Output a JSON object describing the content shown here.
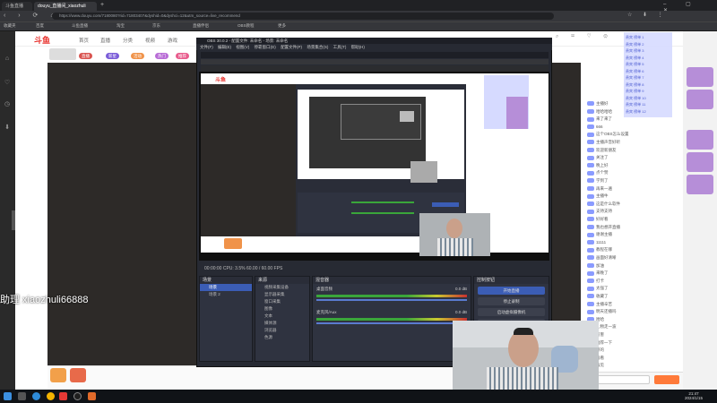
{
  "browser": {
    "tabs": [
      {
        "label": "斗鱼直播",
        "active": false
      },
      {
        "label": "douyu_直播间_xiaozhuli",
        "active": true
      },
      {
        "label": "",
        "active": false
      }
    ],
    "url": "https://www.douyu.com/7180080?rid=71803407&dyshid=0&dyshci=12&utm_source=live_recommend",
    "bookmarks": [
      "收藏夹",
      "百度",
      "斗鱼直播",
      "淘宝",
      "京东",
      "直播伴侣",
      "OBS教程",
      "更多"
    ]
  },
  "site": {
    "logo": "斗鱼",
    "nav": [
      "首页",
      "直播",
      "分类",
      "视频",
      "游戏"
    ],
    "chips": [
      "直播",
      "新星",
      "活动",
      "热门",
      "推荐"
    ],
    "rail_icons": [
      "home-icon",
      "follow-icon",
      "history-icon",
      "download-icon"
    ]
  },
  "obs": {
    "title": "OBS 30.0.2 - 配置文件: 未命名 - 场景: 未命名",
    "menu": [
      "文件(F)",
      "编辑(E)",
      "视图(V)",
      "停靠窗口(D)",
      "配置文件(P)",
      "场景集合(S)",
      "工具(T)",
      "帮助(H)"
    ],
    "scenes_header": "场景",
    "sources_header": "来源",
    "mixer_header": "混音器",
    "controls_header": "控制按钮",
    "scene_items": [
      "场景",
      "场景 2"
    ],
    "source_items": [
      "视频采集设备",
      "显示器采集",
      "窗口采集",
      "图像",
      "文本",
      "媒体源",
      "浏览器",
      "色源"
    ],
    "mixer_tracks": [
      "桌面音频",
      "麦克风/Aux"
    ],
    "mixer_db": [
      "0.0 dB",
      "0.0 dB"
    ],
    "buttons": [
      "开始直播",
      "停止录制",
      "启动虚拟摄像机",
      "工作室模式",
      "设置",
      "退出"
    ],
    "status": "00:00:00  CPU: 3.5%  60.00 / 60.00 FPS",
    "preview_overlay": "助理 xiaozhuli66888"
  },
  "chat": {
    "gift_rows": [
      "贵宾 榜单 1",
      "贵宾 榜单 2",
      "贵宾 榜单 3",
      "贵宾 榜单 4",
      "贵宾 榜单 5",
      "贵宾 榜单 6",
      "贵宾 榜单 7",
      "贵宾 榜单 8",
      "贵宾 榜单 9",
      "贵宾 榜单 10",
      "贵宾 榜单 11",
      "贵宾 榜单 12"
    ],
    "messages": [
      "主播好",
      "哈哈哈哈",
      "来了来了",
      "666",
      "这个OBS怎么设置",
      "主播声音好听",
      "欢迎新朋友",
      "关注了",
      "晚上好",
      "点个赞",
      "学到了",
      "再来一遍",
      "主播牛",
      "这是什么软件",
      "支持支持",
      "好好看",
      "我也想开直播",
      "谢谢主播",
      "11111",
      "教程在哪",
      "画面好清晰",
      "加油",
      "来晚了",
      "打卡",
      "太强了",
      "收藏了",
      "主播辛苦",
      "明天还播吗",
      "哈哈",
      "礼物走一波",
      "厉害",
      "推荐一下",
      "好的",
      "看看",
      "再见"
    ]
  },
  "overlay": {
    "text": "助理 xiaozhuli66888"
  },
  "taskbar": {
    "time": "21:47",
    "date": "2024/1/15"
  }
}
